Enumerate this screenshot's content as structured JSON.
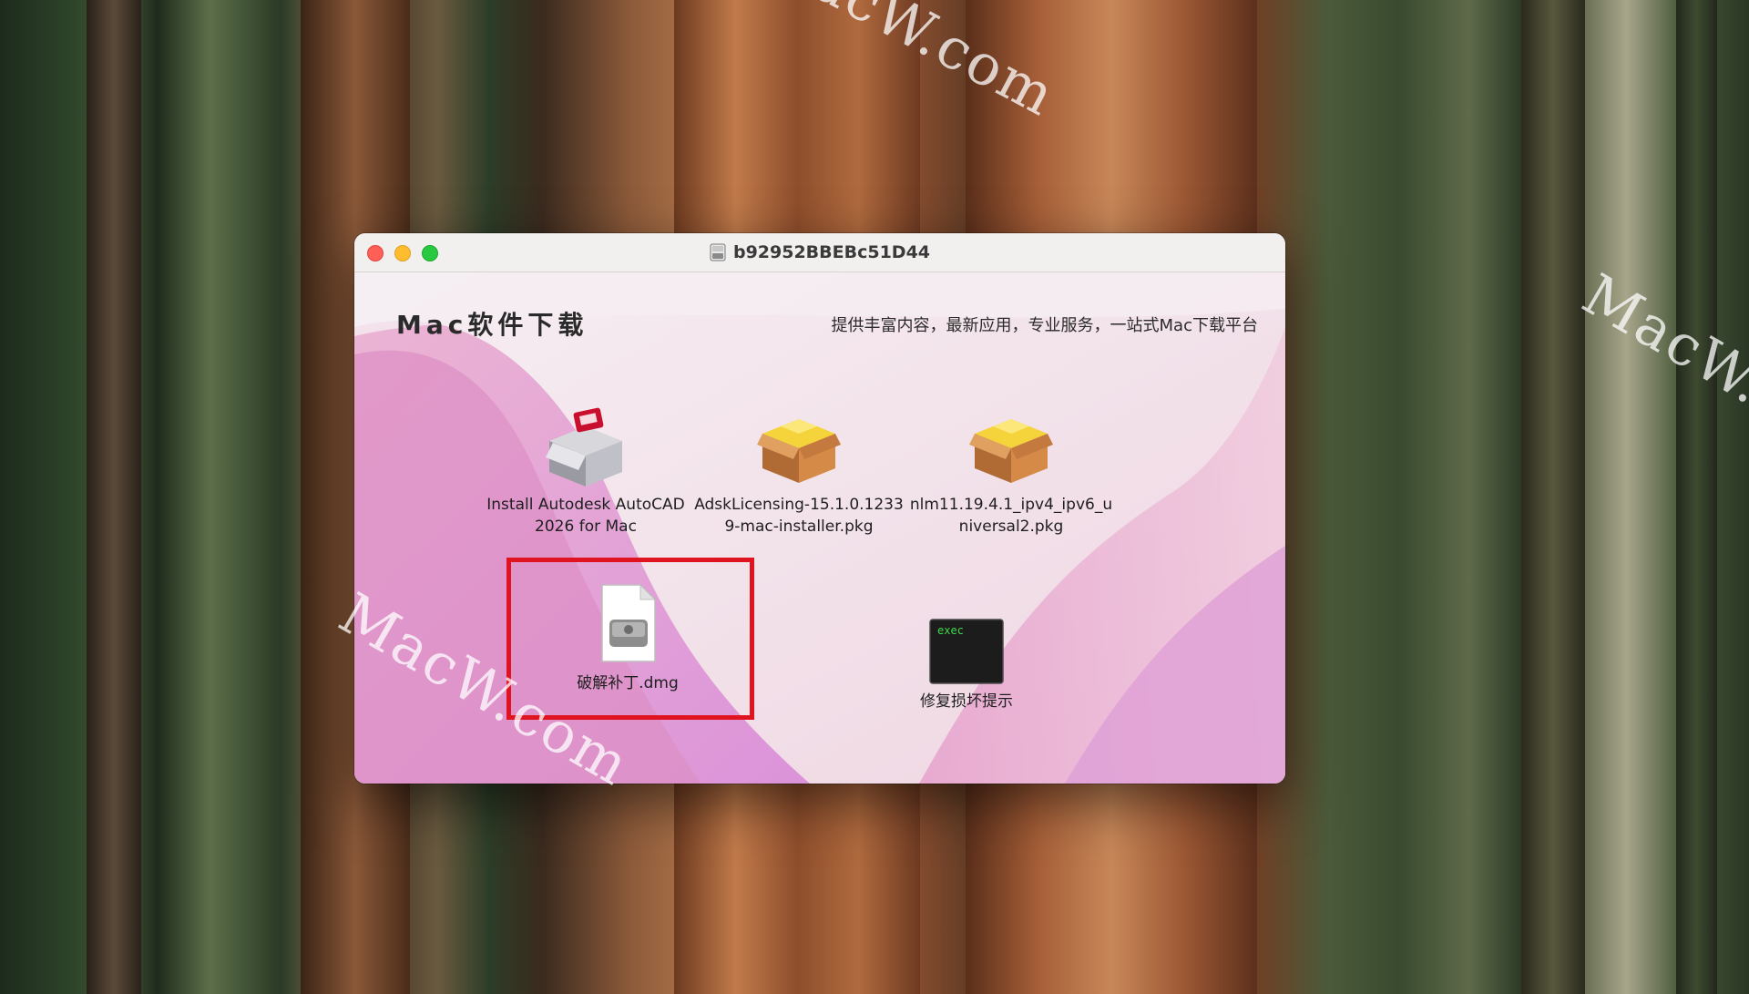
{
  "window": {
    "title": "b92952BBEBc51D44"
  },
  "brand": {
    "title": "Mac软件下载",
    "slogan": "提供丰富内容，最新应用，专业服务，一站式Mac下载平台"
  },
  "watermark": {
    "text": "MacW.com"
  },
  "files": [
    {
      "label": "Install Autodesk AutoCAD 2026 for Mac",
      "icon": "installer-app-icon"
    },
    {
      "label": "AdskLicensing-15.1.0.12339-mac-installer.pkg",
      "icon": "package-icon"
    },
    {
      "label": "nlm11.19.4.1_ipv4_ipv6_universal2.pkg",
      "icon": "package-icon"
    },
    {
      "label": "破解补丁.dmg",
      "icon": "disk-image-icon",
      "selected": true
    },
    {
      "label": "修复损坏提示",
      "icon": "terminal-exec-icon",
      "icon_text": "exec"
    }
  ],
  "colors": {
    "close": "#fe5f57",
    "minimize": "#febc2e",
    "zoom": "#28c840",
    "highlight": "#e01420"
  }
}
